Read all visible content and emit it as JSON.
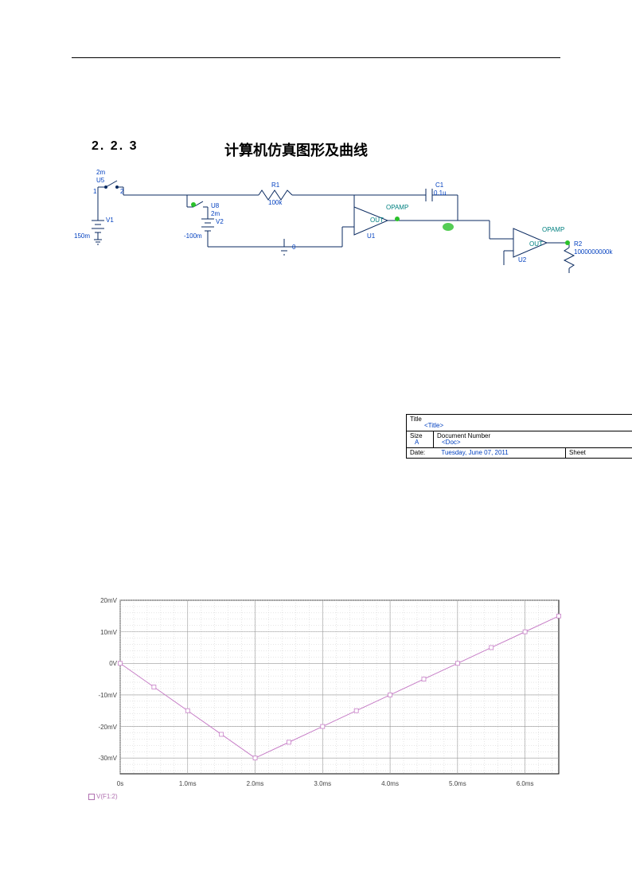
{
  "section": {
    "number": "2. 2. 3",
    "title": "计算机仿真图形及曲线"
  },
  "schematic": {
    "labels": {
      "U5_time": "2m",
      "U5": "U5",
      "U5_1": "1",
      "U5_2": "2",
      "V1": "V1",
      "V1_val": "150m",
      "U8": "U8",
      "U8_time": "2m",
      "V2": "V2",
      "V2_val": "-100m",
      "R1": "R1",
      "R1_val": "100k",
      "C1": "C1",
      "C1_val": "0.1u",
      "OPAMP1": "OPAMP",
      "OUT1": "OUT",
      "U1": "U1",
      "OPAMP2": "OPAMP",
      "OUT2": "OUT",
      "U2": "U2",
      "R2": "R2",
      "R2_val": "1000000000k",
      "gnd": "0"
    }
  },
  "title_block": {
    "title_key": "Title",
    "title_val": "<Title>",
    "size_key": "Size",
    "size_val": "A",
    "docnum_key": "Document Number",
    "docnum_val": "<Doc>",
    "date_key": "Date:",
    "date_val": "Tuesday, June 07, 2011",
    "sheet_key": "Sheet"
  },
  "chart_data": {
    "type": "line",
    "title": "",
    "xlabel": "",
    "ylabel": "",
    "x_unit": "ms",
    "y_unit": "mV",
    "ylim": [
      -35,
      20
    ],
    "xlim": [
      0,
      6.5
    ],
    "y_ticks": [
      20,
      10,
      0,
      -10,
      -20,
      -30
    ],
    "y_tick_labels": [
      "20mV",
      "10mV",
      "0V",
      "-10mV",
      "-20mV",
      "-30mV"
    ],
    "x_ticks": [
      0,
      1,
      2,
      3,
      4,
      5,
      6
    ],
    "x_tick_labels": [
      "0s",
      "1.0ms",
      "2.0ms",
      "3.0ms",
      "4.0ms",
      "5.0ms",
      "6.0ms"
    ],
    "series": [
      {
        "name": "V(F1:2)",
        "color": "#c77fc7",
        "x": [
          0.0,
          0.5,
          1.0,
          1.5,
          2.0,
          2.5,
          3.0,
          3.5,
          4.0,
          4.5,
          5.0,
          5.5,
          6.0,
          6.5
        ],
        "values": [
          0.0,
          -7.5,
          -15.0,
          -22.5,
          -30.0,
          -25.0,
          -20.0,
          -15.0,
          -10.0,
          -5.0,
          0.0,
          5.0,
          10.0,
          15.0
        ]
      }
    ]
  }
}
